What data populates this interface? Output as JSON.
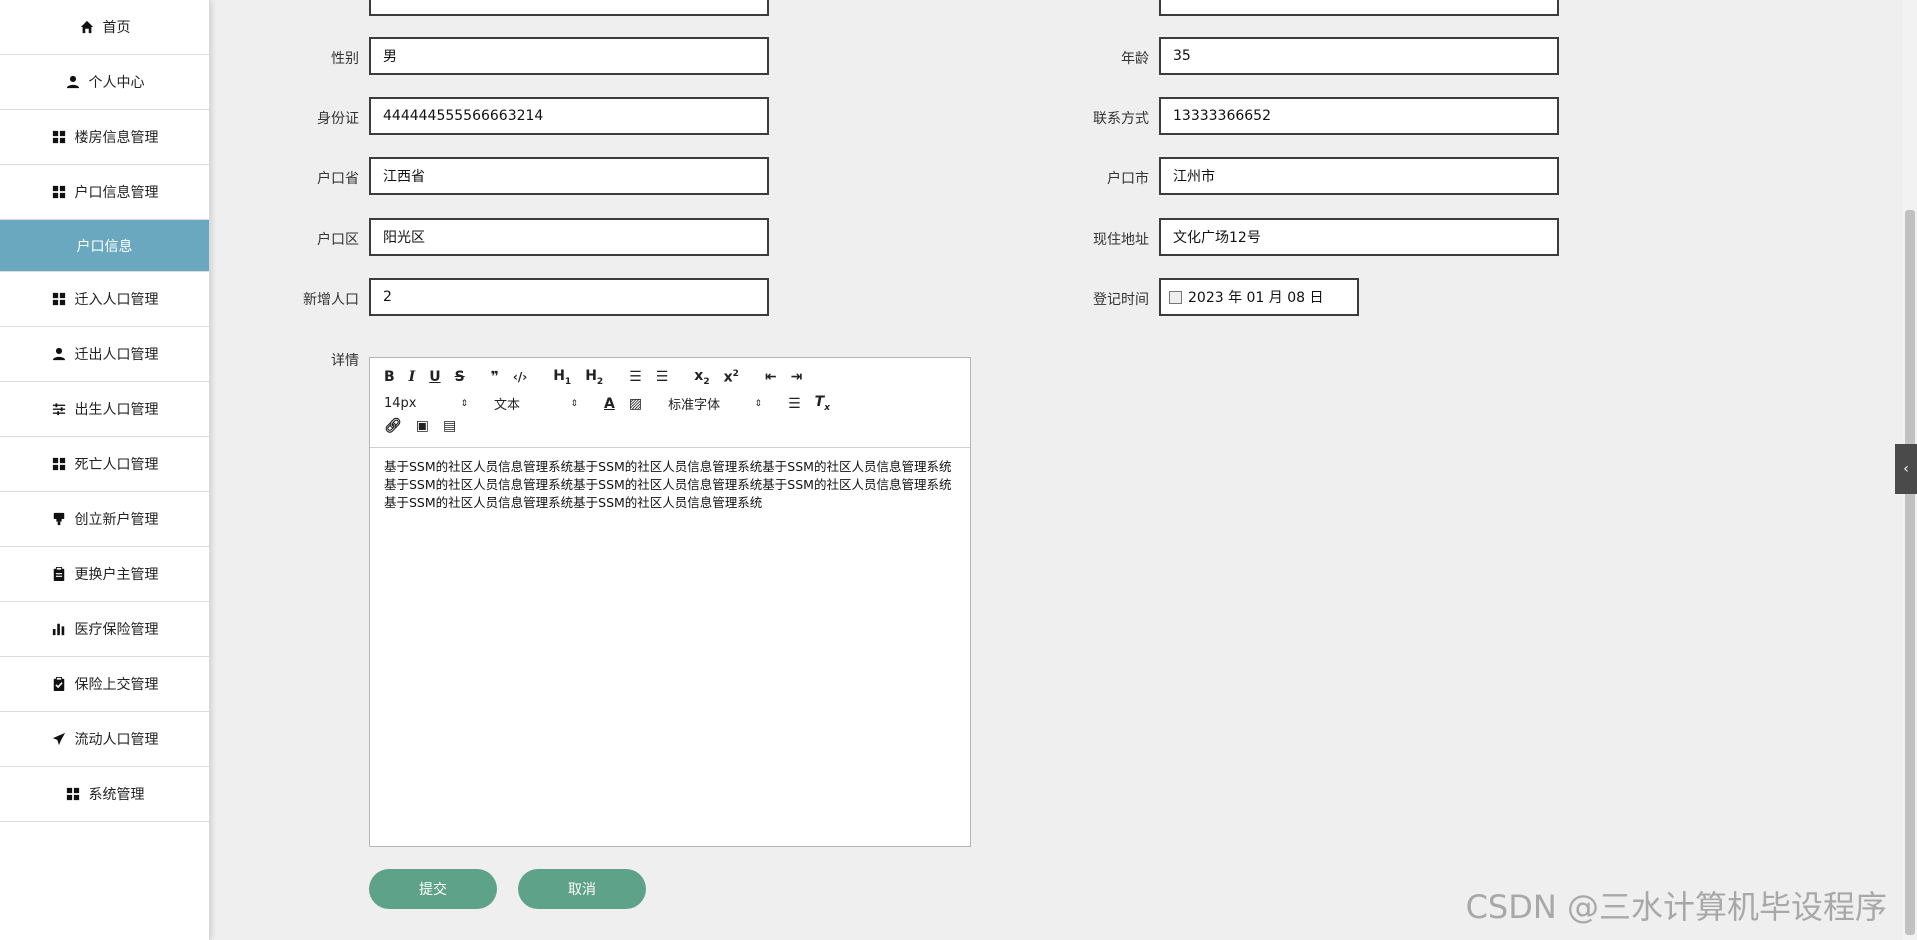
{
  "sidebar": {
    "items": [
      {
        "label": "首页",
        "icon": "home-icon"
      },
      {
        "label": "个人中心",
        "icon": "user-icon"
      },
      {
        "label": "楼房信息管理",
        "icon": "grid-icon"
      },
      {
        "label": "户口信息管理",
        "icon": "grid-icon"
      },
      {
        "label": "户口信息",
        "icon": ""
      },
      {
        "label": "迁入人口管理",
        "icon": "grid-icon"
      },
      {
        "label": "迁出人口管理",
        "icon": "user-icon"
      },
      {
        "label": "出生人口管理",
        "icon": "sliders-icon"
      },
      {
        "label": "死亡人口管理",
        "icon": "grid-icon"
      },
      {
        "label": "创立新户管理",
        "icon": "stamp-icon"
      },
      {
        "label": "更换户主管理",
        "icon": "clipboard-icon"
      },
      {
        "label": "医疗保险管理",
        "icon": "bar-chart-icon"
      },
      {
        "label": "保险上交管理",
        "icon": "clipboard-check-icon"
      },
      {
        "label": "流动人口管理",
        "icon": "paper-plane-icon"
      },
      {
        "label": "系统管理",
        "icon": "grid-icon"
      }
    ]
  },
  "form": {
    "gender_label": "性别",
    "gender_value": "男",
    "age_label": "年龄",
    "age_value": "35",
    "idcard_label": "身份证",
    "idcard_value": "444444555566663214",
    "contact_label": "联系方式",
    "contact_value": "13333366652",
    "province_label": "户口省",
    "province_value": "江西省",
    "city_label": "户口市",
    "city_value": "江州市",
    "district_label": "户口区",
    "district_value": "阳光区",
    "address_label": "现住地址",
    "address_value": "文化广场12号",
    "newpeople_label": "新增人口",
    "newpeople_value": "2",
    "regtime_label": "登记时间",
    "regtime_value": "2023 年 01 月 08 日",
    "detail_label": "详情"
  },
  "editor": {
    "font_size": "14px",
    "text_type": "文本",
    "font_family": "标准字体",
    "content": "基于SSM的社区人员信息管理系统基于SSM的社区人员信息管理系统基于SSM的社区人员信息管理系统基于SSM的社区人员信息管理系统基于SSM的社区人员信息管理系统基于SSM的社区人员信息管理系统基于SSM的社区人员信息管理系统基于SSM的社区人员信息管理系统"
  },
  "buttons": {
    "submit": "提交",
    "cancel": "取消"
  },
  "watermark": "CSDN @三水计算机毕设程序",
  "colors": {
    "active_sidebar": "#6aa8bf",
    "button": "#5fa28a"
  }
}
